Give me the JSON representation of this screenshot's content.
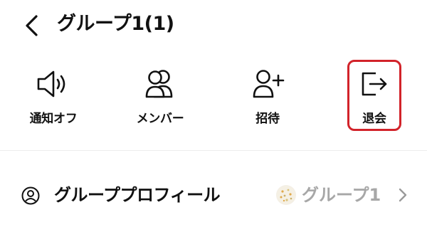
{
  "header": {
    "back_icon": "chevron-left-icon",
    "title": "グループ1(1)"
  },
  "actions": [
    {
      "label": "通知オフ",
      "icon": "speaker-icon"
    },
    {
      "label": "メンバー",
      "icon": "members-icon"
    },
    {
      "label": "招待",
      "icon": "add-person-icon"
    },
    {
      "label": "退会",
      "icon": "leave-icon"
    }
  ],
  "highlight": {
    "color": "#d2232a",
    "target": "退会"
  },
  "profile": {
    "icon": "person-circle-icon",
    "label": "グループプロフィール",
    "group_name": "グループ1",
    "chevron_icon": "chevron-right-icon"
  }
}
